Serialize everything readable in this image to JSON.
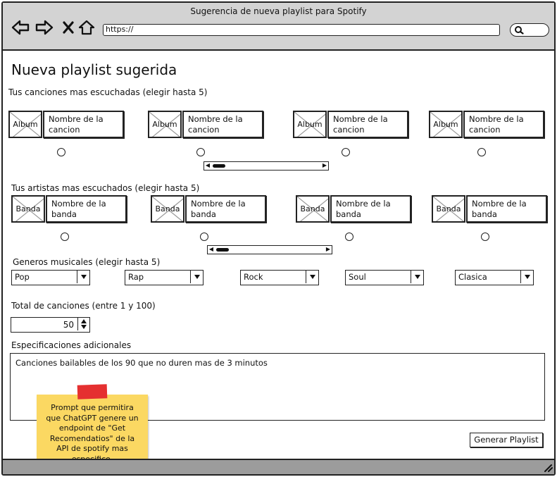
{
  "window": {
    "title": "Sugerencia de nueva playlist para Spotify",
    "url": "https://",
    "nav_icons": [
      "back-arrow-icon",
      "forward-arrow-icon",
      "close-x-icon",
      "home-icon"
    ],
    "search_icon": "search-icon"
  },
  "page": {
    "heading": "Nueva playlist sugerida"
  },
  "songs": {
    "label": "Tus canciones mas escuchadas (elegir hasta 5)",
    "items": [
      {
        "thumb": "Album",
        "name": "Nombre de la cancion"
      },
      {
        "thumb": "Album",
        "name": "Nombre de la cancion"
      },
      {
        "thumb": "Album",
        "name": "Nombre de la cancion"
      },
      {
        "thumb": "Album",
        "name": "Nombre de la cancion"
      }
    ]
  },
  "artists": {
    "label": "Tus artistas mas escuchados (elegir hasta 5)",
    "items": [
      {
        "thumb": "Banda",
        "name": "Nombre de la banda"
      },
      {
        "thumb": "Banda",
        "name": "Nombre de la banda"
      },
      {
        "thumb": "Banda",
        "name": "Nombre de la banda"
      },
      {
        "thumb": "Banda",
        "name": "Nombre de la banda"
      }
    ]
  },
  "genres": {
    "label": "Generos musicales (elegir hasta 5)",
    "selects": [
      {
        "value": "Pop"
      },
      {
        "value": "Rap"
      },
      {
        "value": "Rock"
      },
      {
        "value": "Soul"
      },
      {
        "value": "Clasica"
      }
    ]
  },
  "total": {
    "label": "Total de canciones (entre 1 y 100)",
    "value": "50"
  },
  "specs": {
    "label": "Especificaciones adicionales",
    "value": "Canciones bailables de los 90 que no duren mas de 3 minutos"
  },
  "note": {
    "text": "Prompt que permitira que ChatGPT genere un endpoint de \"Get Recomendatios\" de la API de spotify mas especifico.",
    "color": "#fbd862",
    "tape_color": "#e53030"
  },
  "generate_button": {
    "label": "Generar Playlist"
  },
  "colors": {
    "toolbar": "#d3d3d3",
    "statusbar": "#9c9c9c",
    "ink": "#222222"
  }
}
